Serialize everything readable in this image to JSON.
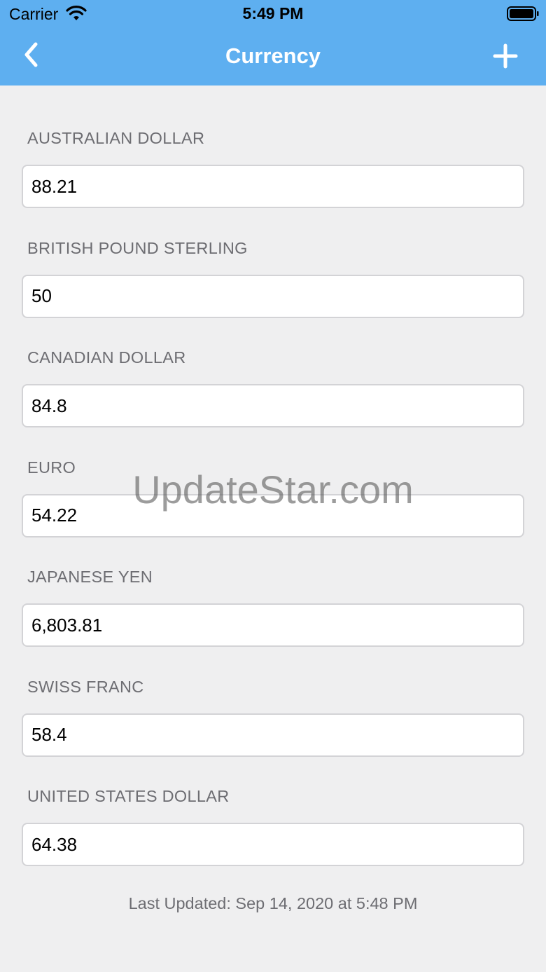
{
  "status_bar": {
    "carrier": "Carrier",
    "time": "5:49 PM"
  },
  "nav": {
    "title": "Currency",
    "back_icon": "chevron-left-icon",
    "add_icon": "plus-icon"
  },
  "currencies": [
    {
      "label": "AUSTRALIAN DOLLAR",
      "value": "88.21"
    },
    {
      "label": "BRITISH POUND STERLING",
      "value": "50"
    },
    {
      "label": "CANADIAN DOLLAR",
      "value": "84.8"
    },
    {
      "label": "EURO",
      "value": "54.22"
    },
    {
      "label": "JAPANESE YEN",
      "value": "6,803.81"
    },
    {
      "label": "SWISS FRANC",
      "value": "58.4"
    },
    {
      "label": "UNITED STATES DOLLAR",
      "value": "64.38"
    }
  ],
  "footer": {
    "last_updated": "Last Updated: Sep 14, 2020 at 5:48 PM"
  },
  "watermark": "UpdateStar.com",
  "colors": {
    "nav_background": "#5eaff0",
    "page_background": "#efeff0"
  }
}
